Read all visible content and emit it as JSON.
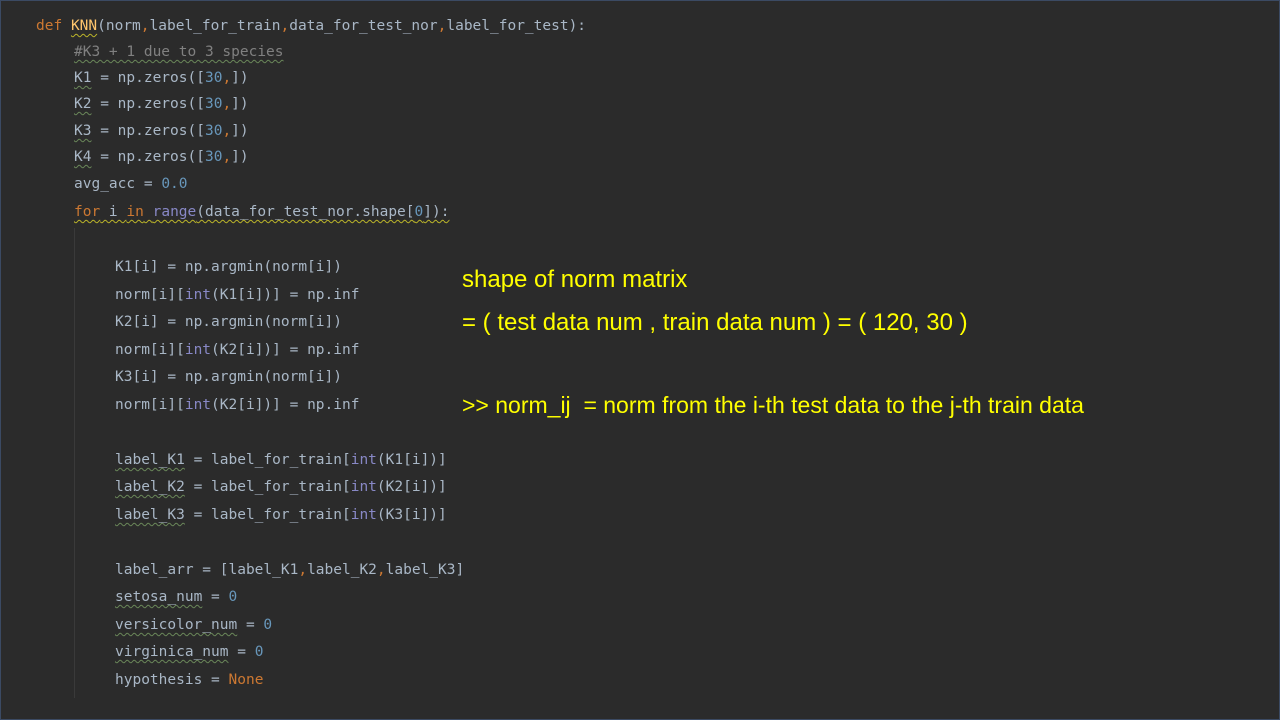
{
  "colors": {
    "background": "#2b2b2b",
    "keyword": "#cc7832",
    "function_name": "#ffc66d",
    "number": "#6897bb",
    "comment": "#808080",
    "builtin": "#8888c6",
    "default_text": "#a9b7c6",
    "annotation": "#ffff00"
  },
  "code": {
    "def_kw": "def",
    "func_name": "KNN",
    "signature_open": "(norm",
    "sig_p2": "label_for_train",
    "sig_p3": "data_for_test_nor",
    "sig_p4": "label_for_test",
    "signature_close": "):",
    "comment": "#K3 + 1 due to 3 species",
    "k1": "K1",
    "k2": "K2",
    "k3": "K3",
    "k4": "K4",
    "zeros_call": " = np.zeros([",
    "zeros_num": "30",
    "zeros_close": "])",
    "avg_acc_var": "avg_acc = ",
    "avg_acc_val": "0.0",
    "for_kw": "for",
    "for_i": " i ",
    "in_kw": "in",
    "range_bi": "range",
    "for_rest": "(data_for_test_nor.shape[",
    "for_zero": "0",
    "for_close": "]):",
    "line_k1_argmin": "K1[i] = np.argmin(norm[i])",
    "norm_idx_pre": "norm[i][",
    "int_bi": "int",
    "norm_k1_rest": "(K1[i])] = np.inf",
    "line_k2_argmin": "K2[i] = np.argmin(norm[i])",
    "norm_k2_rest": "(K2[i])] = np.inf",
    "line_k3_argmin": "K3[i] = np.argmin(norm[i])",
    "norm_k3_rest": "(K2[i])] = np.inf",
    "label_k1": "label_K1",
    "label_k2": "label_K2",
    "label_k3": "label_K3",
    "label_assign": " = label_for_train[",
    "label_k1_rest": "(K1[i])]",
    "label_k2_rest": "(K2[i])]",
    "label_k3_rest": "(K3[i])]",
    "label_arr_pre": "label_arr = [label_K1",
    "label_arr_mid": "label_K2",
    "label_arr_end": "label_K3]",
    "setosa": "setosa_num",
    "versicolor": "versicolor_num",
    "virginica": "virginica_num",
    "eq": " = ",
    "zero": "0",
    "hypothesis": "hypothesis = ",
    "none_kw": "None",
    "comma": ","
  },
  "annotation": {
    "line1": "shape of norm matrix",
    "line2": "= ( test data num , train data num ) = ( 120, 30 )",
    "line3": ">> norm_ij  = norm from the i-th test data to the j-th train data"
  }
}
